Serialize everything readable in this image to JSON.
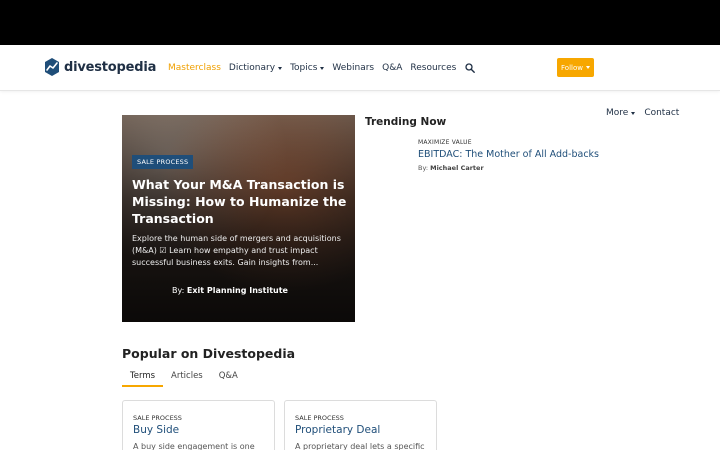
{
  "brand": {
    "name": "divestopedia"
  },
  "nav": {
    "items": [
      {
        "label": "Masterclass",
        "dropdown": false,
        "highlight": true
      },
      {
        "label": "Dictionary",
        "dropdown": true
      },
      {
        "label": "Topics",
        "dropdown": true
      },
      {
        "label": "Webinars",
        "dropdown": false
      },
      {
        "label": "Q&A",
        "dropdown": false
      },
      {
        "label": "Resources",
        "dropdown": false
      }
    ],
    "follow_label": "Follow",
    "more_label": "More",
    "contact_label": "Contact"
  },
  "hero": {
    "badge": "SALE PROCESS",
    "title": "What Your M&A Transaction is Missing: How to Humanize the Transaction",
    "description": "Explore the human side of mergers and acquisitions (M&A) ☑ Learn how empathy and trust impact successful business exits. Gain insights from...",
    "byline_prefix": "By:",
    "author": "Exit Planning Institute"
  },
  "trending": {
    "heading": "Trending Now",
    "items": [
      {
        "kicker": "MAXIMIZE VALUE",
        "title": "EBITDAC: The Mother of All Add-backs",
        "by_prefix": "By:",
        "author": "Michael Carter"
      }
    ]
  },
  "popular": {
    "heading": "Popular on Divestopedia",
    "tabs": [
      {
        "label": "Terms",
        "active": true
      },
      {
        "label": "Articles",
        "active": false
      },
      {
        "label": "Q&A",
        "active": false
      }
    ],
    "cards": [
      {
        "kicker": "SALE PROCESS",
        "title": "Buy Side",
        "description": "A buy side engagement is one"
      },
      {
        "kicker": "SALE PROCESS",
        "title": "Proprietary Deal",
        "description": "A proprietary deal lets a specific"
      }
    ]
  },
  "colors": {
    "accent": "#f7a700",
    "link": "#1f4e79",
    "brand_dark": "#1f2f44",
    "masterclass": "#f0a000"
  },
  "icons": {
    "logo": "trend-line-logo-icon",
    "search": "search-icon",
    "caret": "chevron-down-icon"
  }
}
